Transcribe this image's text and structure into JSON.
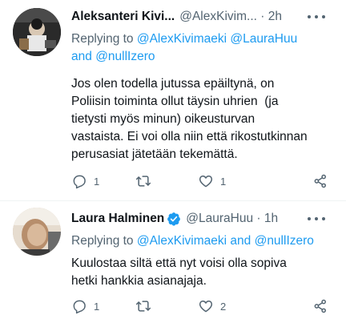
{
  "tweets": [
    {
      "name": "Aleksanteri Kivi...",
      "handle": "@AlexKivim...",
      "time": "2h",
      "reply_prefix": "Replying to",
      "reply_mentions": [
        "@AlexKivimaeki",
        "@LauraHuu",
        "@nullIzero"
      ],
      "reply_join": "and",
      "body_lines": [
        "Jos olen todella jutussa epäiltynä, on",
        "Poliisin toiminta ollut täysin uhrien  (ja",
        "tietysti myös minun) oikeusturvan",
        "vastaista. Ei voi olla niin että rikostutkinnan",
        "perusasiat jätetään tekemättä."
      ],
      "reply_count": "1",
      "retweet_count": "",
      "like_count": "1"
    },
    {
      "name": "Laura Halminen",
      "handle": "@LauraHuu",
      "time": "1h",
      "reply_prefix": "Replying to",
      "reply_mentions": [
        "@AlexKivimaeki",
        "@nullIzero"
      ],
      "reply_join": "and",
      "body_lines": [
        "Kuulostaa siltä että nyt voisi olla sopiva",
        "hetki hankkia asianajaja."
      ],
      "reply_count": "1",
      "retweet_count": "",
      "like_count": "2"
    }
  ],
  "icons": {
    "reply": "reply-icon",
    "retweet": "retweet-icon",
    "like": "heart-icon",
    "share": "share-icon",
    "more": "more-icon",
    "verified": "verified-badge-icon"
  },
  "colors": {
    "text": "#0f1419",
    "secondary": "#536471",
    "link": "#1d9bf0",
    "verified": "#1d9bf0"
  }
}
